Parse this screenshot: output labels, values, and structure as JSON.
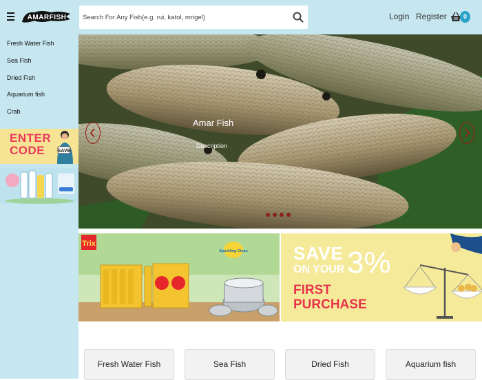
{
  "header": {
    "logo_text": "AMARFISH",
    "search": {
      "placeholder": "Search For Any Fish(e.g. rui, katol, mrigel)",
      "value": ""
    },
    "login_label": "Login",
    "register_label": "Register",
    "cart_count": "0",
    "icons": [
      "menu-icon",
      "search-icon",
      "basket-icon"
    ]
  },
  "sidebar": {
    "items": [
      {
        "label": "Fresh Water Fish"
      },
      {
        "label": "Sea Fish"
      },
      {
        "label": "Dried Fish"
      },
      {
        "label": "Aquarium fish"
      },
      {
        "label": "Crab"
      }
    ],
    "promo_code": {
      "line1": "ENTER",
      "line2": "CODE",
      "badge": "SAVE"
    }
  },
  "slider": {
    "title": "Amar Fish",
    "description": "Description",
    "dot_count": 4,
    "arrow_color": "#9b1a16"
  },
  "banners": {
    "left": {
      "brand": "Trix",
      "tag": "Sparkling Clean"
    },
    "right": {
      "line1": "SAVE",
      "line2": "ON YOUR",
      "percent": "3%",
      "line3": "FIRST",
      "line4": "PURCHASE"
    }
  },
  "category_cards": [
    {
      "label": "Fresh Water Fish"
    },
    {
      "label": "Sea Fish"
    },
    {
      "label": "Dried Fish"
    },
    {
      "label": "Aquarium fish"
    }
  ],
  "colors": {
    "header_bg": "#c6e6f0",
    "accent_badge": "#29a3c7",
    "promo_pink": "#e9385b"
  }
}
